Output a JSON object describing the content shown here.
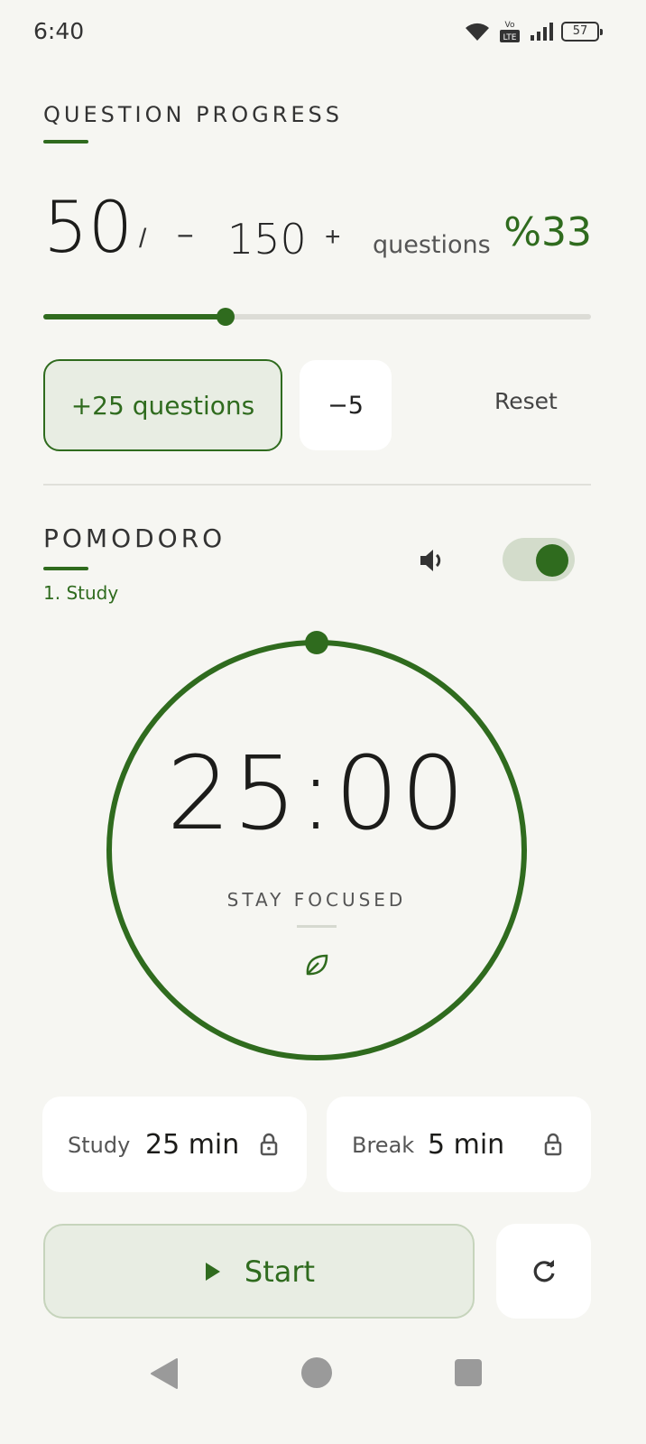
{
  "status_bar": {
    "time": "6:40",
    "battery": "57",
    "network_badge": "LTE"
  },
  "question_progress": {
    "title": "QUESTION PROGRESS",
    "current": "50",
    "separator": "/",
    "decrement_label": "−",
    "total": "150",
    "increment_label": "+",
    "unit": "questions",
    "percent_label": "%33",
    "progress_fraction": 0.3333,
    "add_button_label": "+25 questions",
    "subtract_button_label": "−5",
    "reset_label": "Reset"
  },
  "pomodoro": {
    "title": "POMODORO",
    "phase": "1. Study",
    "sound_icon": "volume-icon",
    "sound_enabled": true,
    "timer": "25:00",
    "subtitle": "STAY FOCUSED",
    "decor_icon": "leaf-icon",
    "remaining_fraction": 1.0,
    "study": {
      "label": "Study",
      "value": "25 min",
      "icon": "lock-icon"
    },
    "break": {
      "label": "Break",
      "value": "5 min",
      "icon": "lock-icon"
    },
    "start_label": "Start",
    "restart_icon": "refresh-icon"
  },
  "colors": {
    "accent": "#2f6b1e",
    "background": "#f6f6f2",
    "tint": "#e8ede3"
  }
}
